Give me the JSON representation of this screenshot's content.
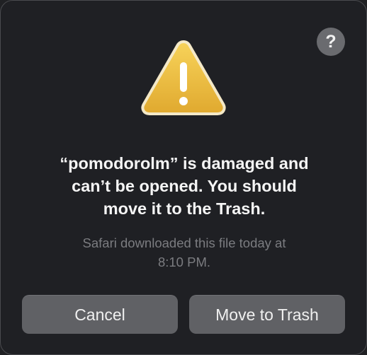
{
  "dialog": {
    "help_label": "?",
    "icon": "warning-triangle-icon",
    "title_lines": [
      "“pomodorolm” is damaged and",
      "can’t be opened. You should",
      "move it to the Trash."
    ],
    "message_lines": [
      "Safari downloaded this file today at",
      "8:10 PM."
    ],
    "buttons": {
      "cancel": "Cancel",
      "move_to_trash": "Move to Trash"
    }
  },
  "colors": {
    "background": "#1f2024",
    "button": "#606165",
    "warning_yellow": "#f2c244",
    "secondary_text": "#7b7c80"
  }
}
